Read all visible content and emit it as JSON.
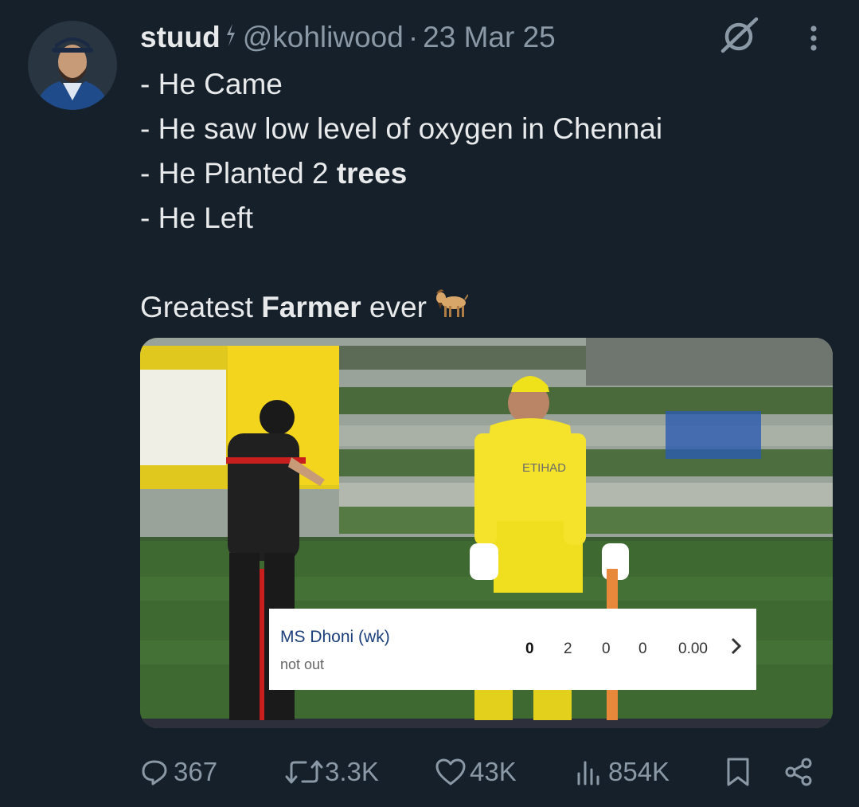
{
  "author": {
    "name": "stuud",
    "handle": "@kohliwood",
    "separator": "·",
    "date": "23 Mar 25"
  },
  "tweet": {
    "lines": [
      "- He Came",
      "- He saw low level of oxygen in Chennai"
    ],
    "line3_prefix": "- He Planted 2 ",
    "line3_bold": "trees",
    "line4": "- He Left",
    "line6_prefix": "Greatest ",
    "line6_bold": "Farmer",
    "line6_suffix": " ever"
  },
  "media": {
    "scorecard": {
      "player": "MS Dhoni (wk)",
      "status": "not out",
      "runs": "0",
      "balls": "2",
      "fours": "0",
      "sixes": "0",
      "strike_rate": "0.00"
    },
    "jersey_text": "ETIHAD"
  },
  "actions": {
    "replies": "367",
    "reposts": "3.3K",
    "likes": "43K",
    "views": "854K"
  },
  "colors": {
    "background": "#15202b",
    "text": "#e7e9ea",
    "muted": "#8b98a5"
  }
}
